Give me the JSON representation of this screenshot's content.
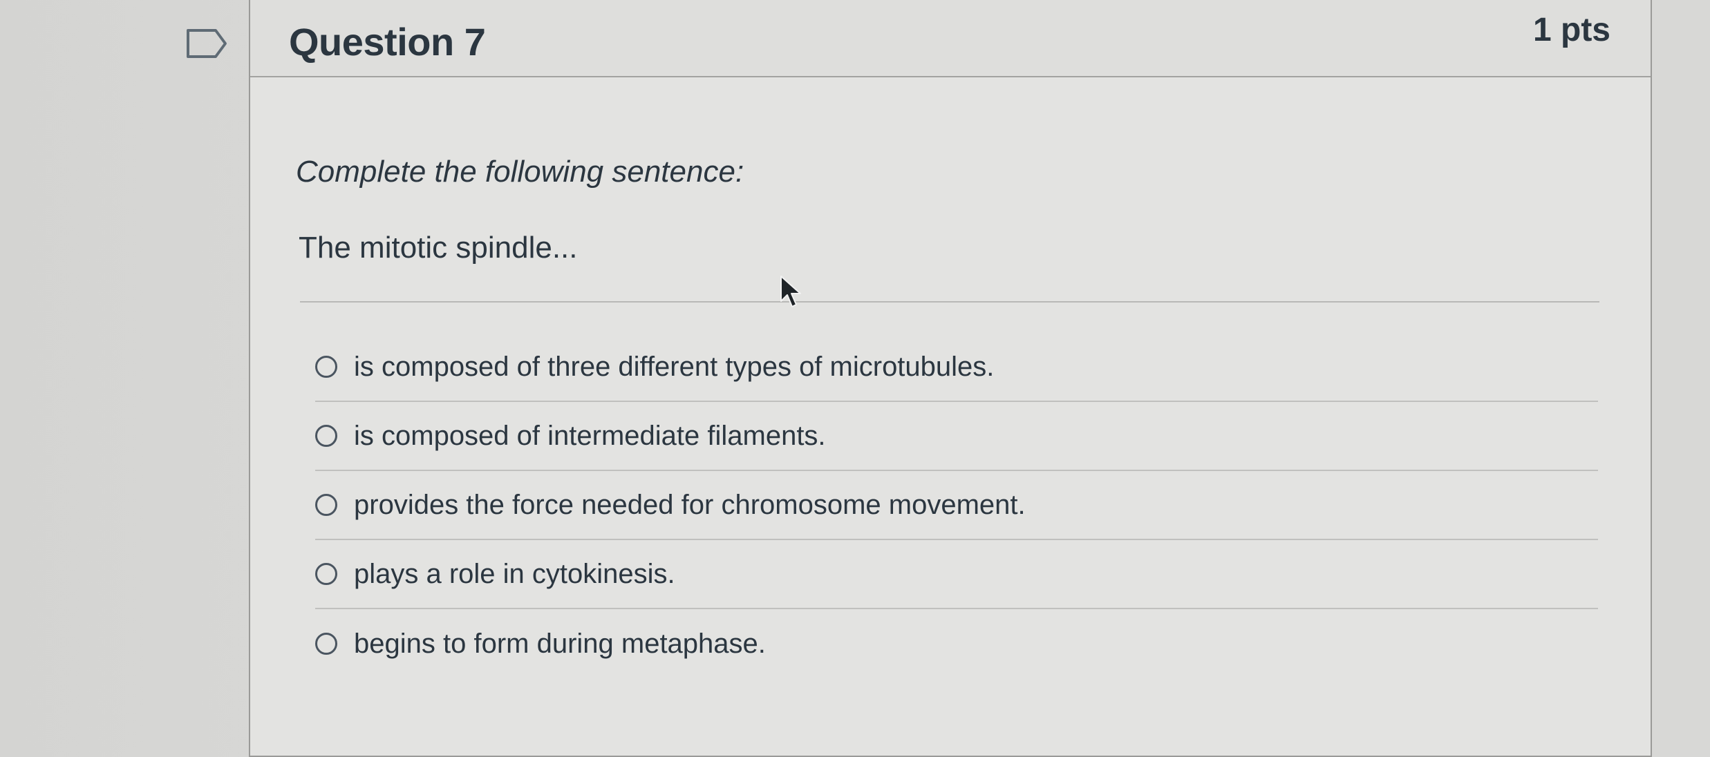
{
  "question": {
    "title": "Question 7",
    "points": "1 pts",
    "prompt": "Complete the following sentence:",
    "stem": "The mitotic spindle...",
    "answers": [
      {
        "label": "is composed of three different types of microtubules."
      },
      {
        "label": "is composed of intermediate filaments."
      },
      {
        "label": "provides the force needed for chromosome movement."
      },
      {
        "label": "plays a role in cytokinesis."
      },
      {
        "label": "begins to form during metaphase."
      }
    ]
  },
  "icons": {
    "flag": "flag-question-icon",
    "cursor": "mouse-pointer-icon"
  }
}
